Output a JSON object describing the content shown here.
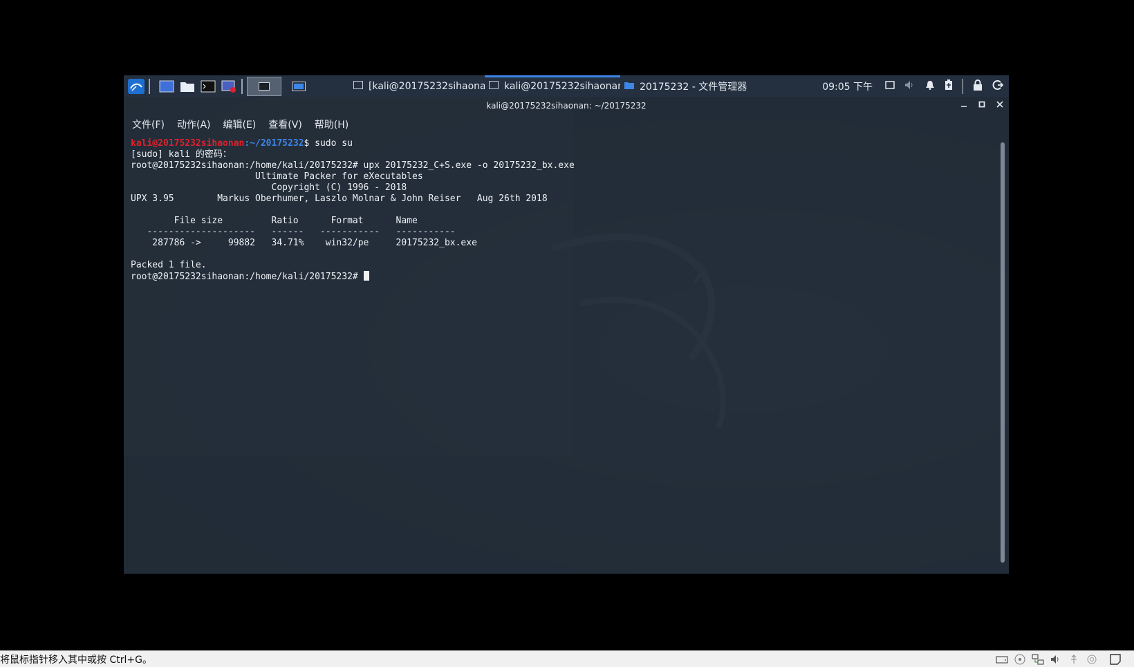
{
  "panel": {
    "tasks": [
      {
        "label": "[kali@20175232sihaona..."
      },
      {
        "label": "kali@20175232sihaonan..."
      },
      {
        "label": "20175232 - 文件管理器"
      }
    ],
    "clock": "09:05 下午"
  },
  "terminal": {
    "title": "kali@20175232sihaonan: ~/20175232",
    "menu": [
      "文件(F)",
      "动作(A)",
      "编辑(E)",
      "查看(V)",
      "帮助(H)"
    ],
    "prompt_user": "kali@20175232sihaonan",
    "prompt_path": ":~/20175232",
    "prompt_cmd": "$ sudo su",
    "lines": [
      "[sudo] kali 的密码：",
      "root@20175232sihaonan:/home/kali/20175232# upx 20175232_C+S.exe -o 20175232_bx.exe",
      "                       Ultimate Packer for eXecutables",
      "                          Copyright (C) 1996 - 2018",
      "UPX 3.95        Markus Oberhumer, Laszlo Molnar & John Reiser   Aug 26th 2018",
      "",
      "        File size         Ratio      Format      Name",
      "   --------------------   ------   -----------   -----------",
      "    287786 ->     99882   34.71%    win32/pe     20175232_bx.exe",
      "",
      "Packed 1 file."
    ],
    "last_prompt": "root@20175232sihaonan:/home/kali/20175232# "
  },
  "hostbar": {
    "hint": "将鼠标指针移入其中或按 Ctrl+G。"
  },
  "colors": {
    "panel_bg": "#243040",
    "accent": "#3c86e8",
    "prompt_user": "#e0202c"
  }
}
